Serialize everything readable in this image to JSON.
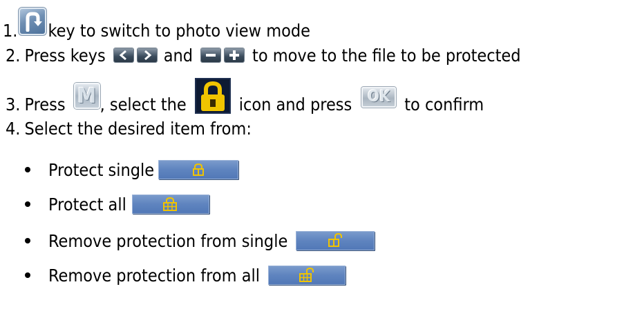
{
  "steps": [
    {
      "number": "1.",
      "text": "key to switch to photo view mode"
    },
    {
      "number": "2.",
      "text_before": "Press keys",
      "text_mid": "and",
      "text_after": "to move to the file to be protected"
    },
    {
      "number": "3.",
      "text_before": "Press",
      "text_mid1": ", select the",
      "text_mid2": "icon and press",
      "text_after": "to confirm"
    },
    {
      "number": "4.",
      "text": "Select the desired item from:"
    }
  ],
  "keys": {
    "left": "<",
    "right": ">",
    "minus": "−",
    "plus": "+",
    "menu": "M",
    "ok": "OK"
  },
  "options": [
    {
      "label": "Protect single",
      "icon": "lock-closed-single-icon"
    },
    {
      "label": "Protect all",
      "icon": "lock-closed-all-icon"
    },
    {
      "label": "Remove protection from single",
      "icon": "lock-open-single-icon"
    },
    {
      "label": "Remove protection from all",
      "icon": "lock-open-all-icon"
    }
  ],
  "colors": {
    "menu_bar": "#5f84bf",
    "lock_gold": "#f0c400",
    "lock_bg": "#0d1a33"
  }
}
